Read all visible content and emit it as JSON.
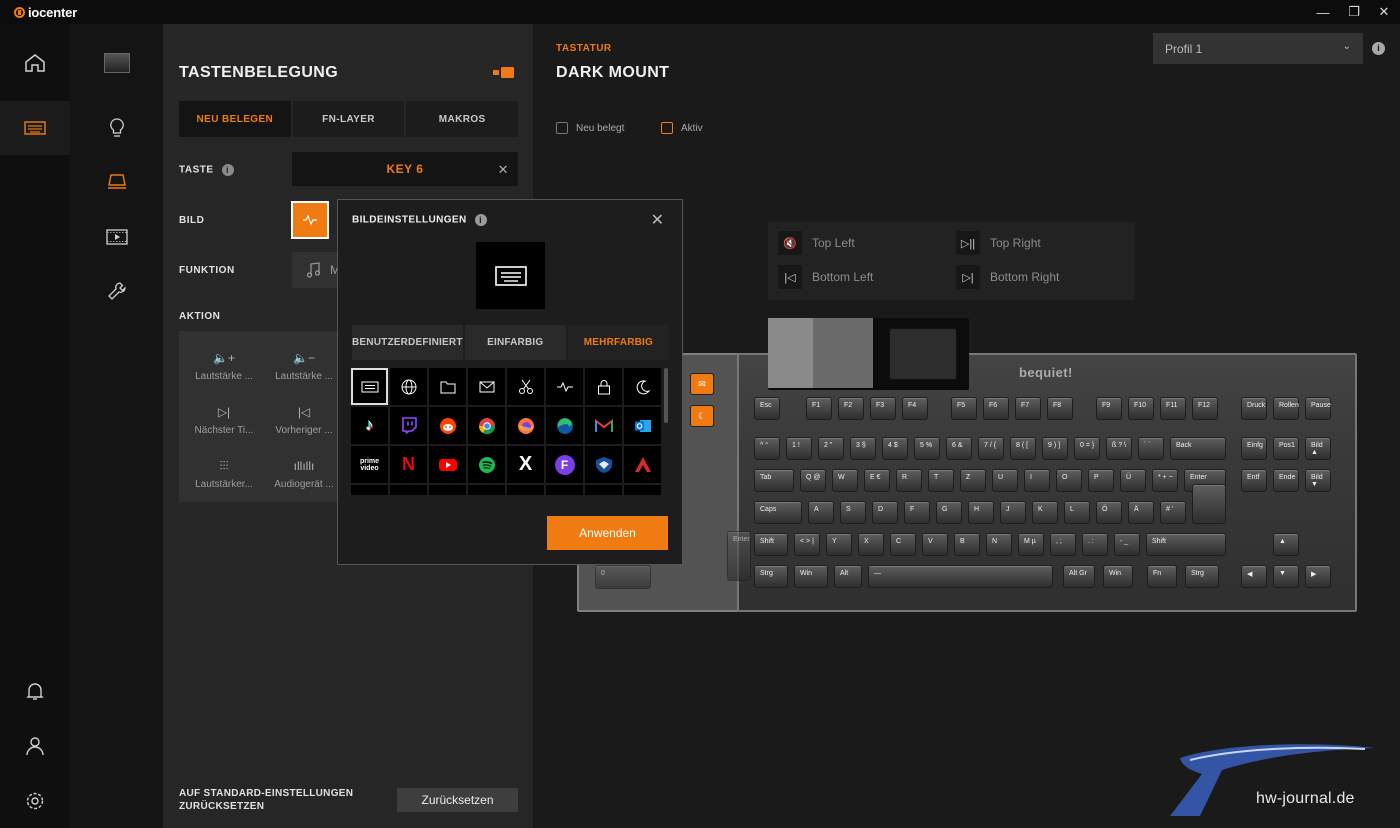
{
  "app": {
    "name": "iocenter"
  },
  "window_controls": {
    "minimize": "—",
    "restore": "❐",
    "close": "✕"
  },
  "nav": [
    "home-icon",
    "keyboard-icon",
    "bell-icon",
    "user-icon",
    "settings-icon"
  ],
  "subnav": [
    "device-thumbnail",
    "bulb-icon",
    "key-icon",
    "media-icon",
    "wrench-icon"
  ],
  "panel": {
    "title": "TASTENBELEGUNG",
    "tabs": [
      "NEU BELEGEN",
      "FN-LAYER",
      "MAKROS"
    ],
    "key_label": "TASTE",
    "key_value": "KEY 6",
    "image_label": "BILD",
    "function_label": "FUNKTION",
    "function_value": "M",
    "action_label": "AKTION",
    "actions": [
      "Lautstärke ...",
      "Lautstärke ...",
      "Nächster Ti...",
      "Vorheriger ...",
      "Lautstärker...",
      "Audiogerät ..."
    ],
    "reset_label_1": "AUF STANDARD-EINSTELLUNGEN",
    "reset_label_2": "ZURÜCKSETZEN",
    "reset_button": "Zurücksetzen"
  },
  "main": {
    "subtitle": "TASTATUR",
    "title": "DARK MOUNT",
    "profile": "Profil 1",
    "checkbox_new": "Neu belegt",
    "checkbox_active": "Aktiv",
    "corners": [
      "Top Left",
      "Top Right",
      "Bottom Left",
      "Bottom Right"
    ],
    "brand": "bequiet!"
  },
  "modal": {
    "title": "BILDEINSTELLUNGEN",
    "tabs": [
      "BENUTZERDEFINIERT",
      "EINFARBIG",
      "MEHRFARBIG"
    ],
    "icons_row1": [
      "keyboard",
      "globe",
      "folder",
      "mail",
      "scissors",
      "pulse",
      "lock",
      "moon"
    ],
    "icons_row2": [
      "tiktok",
      "twitch",
      "reddit",
      "chrome",
      "firefox",
      "edge",
      "gmail",
      "outlook"
    ],
    "icons_row3": [
      "prime video",
      "netflix",
      "youtube",
      "spotify",
      "x",
      "f",
      "shield",
      "apex"
    ],
    "prime_text": "prime video",
    "apply": "Anwenden"
  },
  "keys": {
    "row0": [
      "Esc",
      "F1",
      "F2",
      "F3",
      "F4",
      "F5",
      "F6",
      "F7",
      "F8",
      "F9",
      "F10",
      "F11",
      "F12",
      "Druck",
      "Rollen",
      "Pause"
    ],
    "row1": [
      "^ °",
      "1 !",
      "2 \"",
      "3 §",
      "4 $",
      "5 %",
      "6 &",
      "7 / {",
      "8 ( [",
      "9 ) ]",
      "0 = }",
      "ß ? \\",
      "´ `",
      "Back",
      "Einfg",
      "Pos1",
      "Bild ▲"
    ],
    "row2": [
      "Tab",
      "Q @",
      "W",
      "E €",
      "R",
      "T",
      "Z",
      "U",
      "I",
      "O",
      "P",
      "Ü",
      "* + ~",
      "Enter",
      "Entf",
      "Ende",
      "Bild ▼"
    ],
    "row3": [
      "Caps",
      "A",
      "S",
      "D",
      "F",
      "G",
      "H",
      "J",
      "K",
      "L",
      "Ö",
      "Ä",
      "# '"
    ],
    "row4": [
      "Shift",
      "< > |",
      "Y",
      "X",
      "C",
      "V",
      "B",
      "N",
      "M µ",
      ", ;",
      ". :",
      "- _",
      "Shift",
      "▲"
    ],
    "row5": [
      "Strg",
      "Win",
      "Alt",
      "—",
      "Alt Gr",
      "Win",
      "Fn",
      "Strg",
      "◀",
      "▼",
      "▶"
    ],
    "left": [
      "Enter",
      "0"
    ]
  },
  "watermark": "hw-journal.de",
  "colors": {
    "accent": "#f07b12",
    "bg": "#1a1a1a",
    "panel": "#262626"
  }
}
